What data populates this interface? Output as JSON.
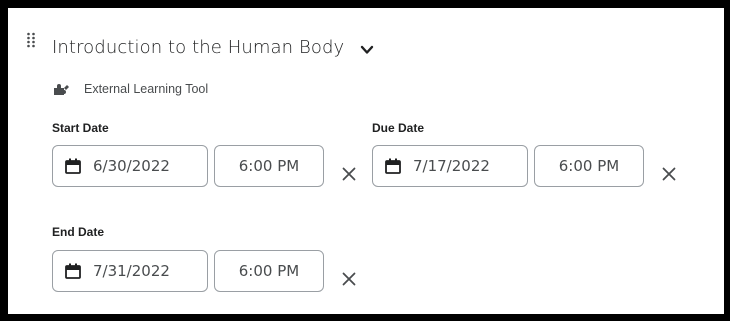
{
  "activity": {
    "title": "Introduction to the Human Body",
    "tool_label": "External Learning Tool"
  },
  "start": {
    "label": "Start Date",
    "date": "6/30/2022",
    "time": "6:00 PM"
  },
  "due": {
    "label": "Due Date",
    "date": "7/17/2022",
    "time": "6:00 PM"
  },
  "end": {
    "label": "End Date",
    "date": "7/31/2022",
    "time": "6:00 PM"
  },
  "icons": {
    "drag": "drag-handle-icon",
    "chevron": "chevron-down-icon",
    "tool": "puzzle-piece-icon",
    "calendar": "calendar-icon",
    "clear": "close-icon"
  },
  "colors": {
    "text": "#202122",
    "secondary_text": "#494c4e",
    "border": "#9a9fa4",
    "frame_border": "#000000"
  }
}
